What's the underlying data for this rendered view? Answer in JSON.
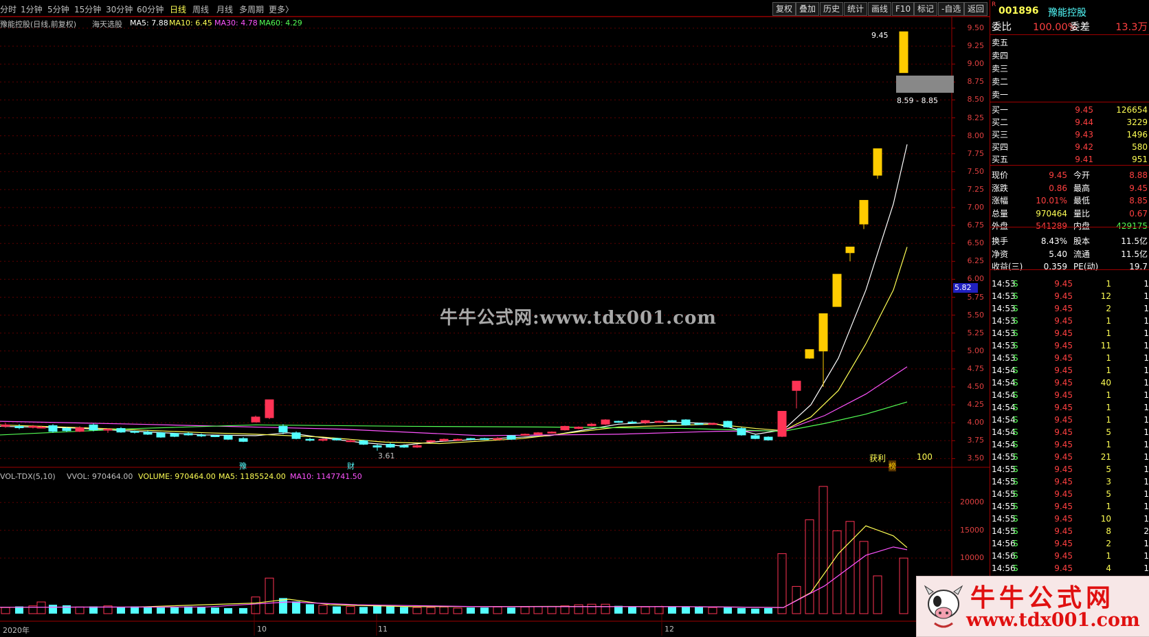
{
  "periods": [
    {
      "label": "分时",
      "active": false
    },
    {
      "label": "1分钟",
      "active": false
    },
    {
      "label": "5分钟",
      "active": false
    },
    {
      "label": "15分钟",
      "active": false
    },
    {
      "label": "30分钟",
      "active": false
    },
    {
      "label": "60分钟",
      "active": false
    },
    {
      "label": "日线",
      "active": true
    },
    {
      "label": "周线",
      "active": false
    },
    {
      "label": "月线",
      "active": false
    },
    {
      "label": "多周期",
      "active": false
    },
    {
      "label": "更多〉",
      "active": false
    }
  ],
  "toolbar": [
    "复权",
    "叠加",
    "历史",
    "统计",
    "画线",
    "F10",
    "标记",
    "-自选",
    "返回"
  ],
  "stock": {
    "code": "001896",
    "name": "豫能控股",
    "r_mark": "R"
  },
  "chart_info": {
    "title": "豫能控股(日线,前复权)",
    "formula": "海天选股",
    "ma5": "MA5: 7.88",
    "ma10": "MA10: 6.45",
    "ma30": "MA30: 4.78",
    "ma60": "MA60: 4.29"
  },
  "vol_info": {
    "name": "VOL-TDX(5,10)",
    "vvol": "VVOL: 970464.00",
    "volume": "VOLUME: 970464.00",
    "ma5": "MA5: 1185524.00",
    "ma10": "MA10: 1147741.50"
  },
  "price_axis": [
    "9.50",
    "9.25",
    "9.00",
    "8.75",
    "8.50",
    "8.25",
    "8.00",
    "7.75",
    "7.50",
    "7.25",
    "7.00",
    "6.75",
    "6.50",
    "6.25",
    "6.00",
    "5.75",
    "5.50",
    "5.25",
    "5.00",
    "4.75",
    "4.50",
    "4.25",
    "4.00",
    "3.75",
    "3.50"
  ],
  "current_price_tag": "5.82",
  "vol_axis": [
    "20000",
    "15000",
    "10000"
  ],
  "annotations": {
    "high": "9.45",
    "range": "8.59 - 8.85",
    "low": "3.61",
    "profit": "获利",
    "profit_val": "100",
    "mark_a": "豫",
    "mark_b": "财",
    "mark_c": "榜"
  },
  "date_axis": [
    "2020年",
    "10",
    "11",
    "12"
  ],
  "watermark": "牛牛公式网:www.tdx001.com",
  "logo": {
    "cn": "牛牛公式网",
    "url": "www.tdx001.com"
  },
  "quote": {
    "wei": {
      "label": "委比",
      "value": "100.00%",
      "label2": "委差",
      "value2": "13.3万"
    },
    "sell": [
      {
        "label": "卖五"
      },
      {
        "label": "卖四"
      },
      {
        "label": "卖三"
      },
      {
        "label": "卖二"
      },
      {
        "label": "卖一"
      }
    ],
    "buy": [
      {
        "label": "买一",
        "price": "9.45",
        "vol": "126654"
      },
      {
        "label": "买二",
        "price": "9.44",
        "vol": "3229"
      },
      {
        "label": "买三",
        "price": "9.43",
        "vol": "1496"
      },
      {
        "label": "买四",
        "price": "9.42",
        "vol": "580"
      },
      {
        "label": "买五",
        "price": "9.41",
        "vol": "951"
      }
    ],
    "stats1": [
      {
        "l1": "现价",
        "v1": "9.45",
        "l2": "今开",
        "v2": "8.88"
      },
      {
        "l1": "涨跌",
        "v1": "0.86",
        "l2": "最高",
        "v2": "9.45"
      },
      {
        "l1": "涨幅",
        "v1": "10.01%",
        "l2": "最低",
        "v2": "8.85"
      },
      {
        "l1": "总量",
        "v1": "970464",
        "l2": "量比",
        "v2": "0.67"
      },
      {
        "l1": "外盘",
        "v1": "541289",
        "l2": "内盘",
        "v2": "429175"
      }
    ],
    "stats2": [
      {
        "l1": "换手",
        "v1": "8.43%",
        "l2": "股本",
        "v2": "11.5亿"
      },
      {
        "l1": "净资",
        "v1": "5.40",
        "l2": "流通",
        "v2": "11.5亿"
      },
      {
        "l1": "收益(三)",
        "v1": "0.359",
        "l2": "PE(动)",
        "v2": "19.7"
      }
    ]
  },
  "ticks": [
    {
      "t": "14:53",
      "p": "9.45",
      "v": "1",
      "s": "S",
      "n": "1"
    },
    {
      "t": "14:53",
      "p": "9.45",
      "v": "12",
      "s": "S",
      "n": "1"
    },
    {
      "t": "14:53",
      "p": "9.45",
      "v": "2",
      "s": "S",
      "n": "1"
    },
    {
      "t": "14:53",
      "p": "9.45",
      "v": "1",
      "s": "S",
      "n": "1"
    },
    {
      "t": "14:53",
      "p": "9.45",
      "v": "1",
      "s": "S",
      "n": "1"
    },
    {
      "t": "14:53",
      "p": "9.45",
      "v": "11",
      "s": "S",
      "n": "1"
    },
    {
      "t": "14:53",
      "p": "9.45",
      "v": "1",
      "s": "S",
      "n": "1"
    },
    {
      "t": "14:54",
      "p": "9.45",
      "v": "1",
      "s": "S",
      "n": "1"
    },
    {
      "t": "14:54",
      "p": "9.45",
      "v": "40",
      "s": "S",
      "n": "1"
    },
    {
      "t": "14:54",
      "p": "9.45",
      "v": "1",
      "s": "S",
      "n": "1"
    },
    {
      "t": "14:54",
      "p": "9.45",
      "v": "1",
      "s": "S",
      "n": "1"
    },
    {
      "t": "14:54",
      "p": "9.45",
      "v": "1",
      "s": "S",
      "n": "1"
    },
    {
      "t": "14:54",
      "p": "9.45",
      "v": "5",
      "s": "S",
      "n": "1"
    },
    {
      "t": "14:54",
      "p": "9.45",
      "v": "1",
      "s": "S",
      "n": "1"
    },
    {
      "t": "14:55",
      "p": "9.45",
      "v": "21",
      "s": "S",
      "n": "1"
    },
    {
      "t": "14:55",
      "p": "9.45",
      "v": "5",
      "s": "S",
      "n": "1"
    },
    {
      "t": "14:55",
      "p": "9.45",
      "v": "3",
      "s": "S",
      "n": "1"
    },
    {
      "t": "14:55",
      "p": "9.45",
      "v": "5",
      "s": "S",
      "n": "1"
    },
    {
      "t": "14:55",
      "p": "9.45",
      "v": "1",
      "s": "S",
      "n": "1"
    },
    {
      "t": "14:55",
      "p": "9.45",
      "v": "10",
      "s": "S",
      "n": "1"
    },
    {
      "t": "14:55",
      "p": "9.45",
      "v": "8",
      "s": "S",
      "n": "2"
    },
    {
      "t": "14:56",
      "p": "9.45",
      "v": "2",
      "s": "S",
      "n": "1"
    },
    {
      "t": "14:56",
      "p": "9.45",
      "v": "1",
      "s": "S",
      "n": "1"
    },
    {
      "t": "14:56",
      "p": "9.45",
      "v": "4",
      "s": "S",
      "n": "1"
    }
  ],
  "colors": {
    "up": "#ff3355",
    "down": "#54ffff",
    "ma5": "#ffffff",
    "ma10": "#ffff54",
    "ma30": "#ff54ff",
    "ma60": "#54ff54",
    "gold": "#ffcc00",
    "grid": "#800000"
  }
}
